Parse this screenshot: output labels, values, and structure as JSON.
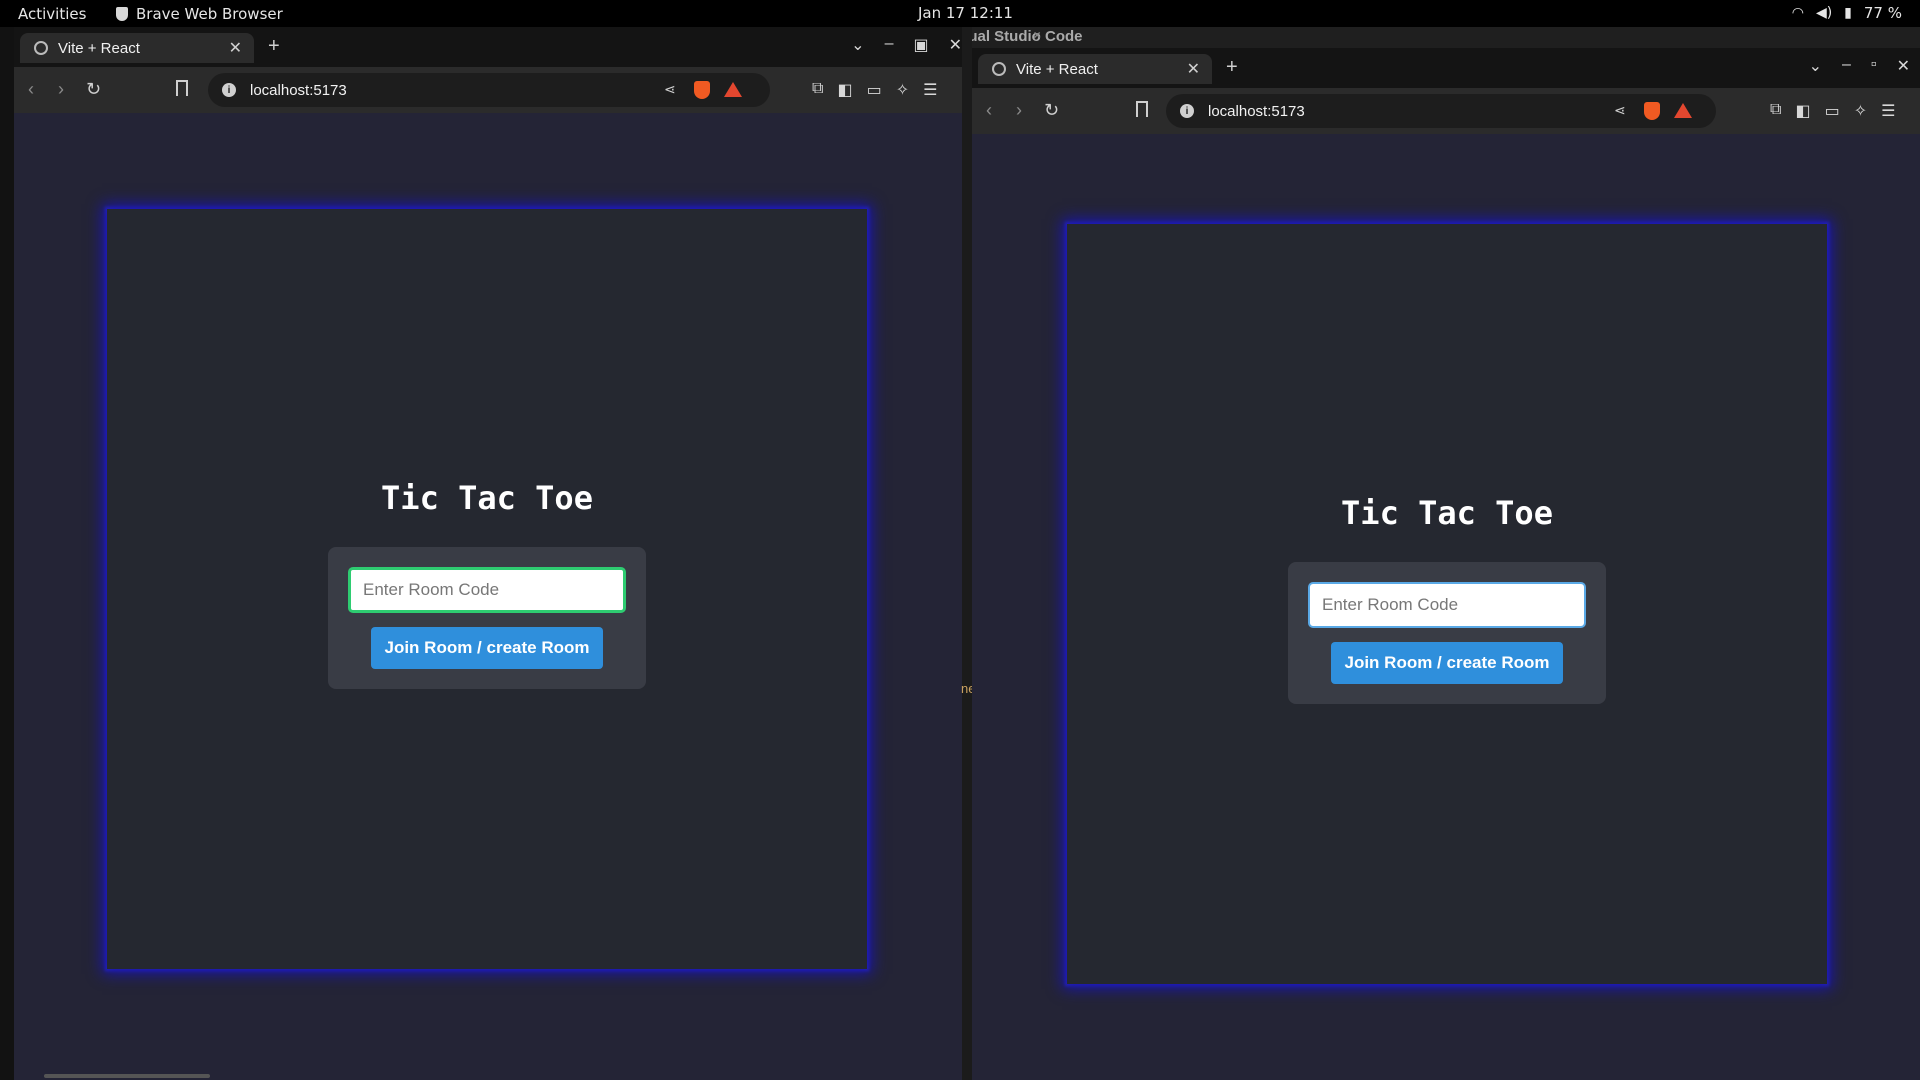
{
  "topbar": {
    "activities": "Activities",
    "app_name": "Brave Web Browser",
    "clock": "Jan 17  12:11",
    "battery": "77 %"
  },
  "background_window": {
    "title": "sual Studio Code",
    "edge_text": "ne"
  },
  "browser_left": {
    "tab_title": "Vite + React",
    "url": "localhost:5173",
    "app": {
      "title": "Tic Tac Toe",
      "input_placeholder": "Enter Room Code",
      "input_value": "",
      "input_focused": true,
      "button_label": "Join Room / create Room"
    }
  },
  "browser_right": {
    "tab_title": "Vite + React",
    "url": "localhost:5173",
    "app": {
      "title": "Tic Tac Toe",
      "input_placeholder": "Enter Room Code",
      "input_value": "",
      "input_focused": false,
      "button_label": "Join Room / create Room"
    }
  },
  "colors": {
    "page_bg": "#242436",
    "card_bg": "#252830",
    "glow": "#1a16a8",
    "form_bg": "#393c45",
    "button": "#2f8fdc",
    "focus_border": "#2ecc71"
  },
  "icons": [
    "globe-icon",
    "close-icon",
    "plus-icon",
    "back-icon",
    "forward-icon",
    "reload-icon",
    "bookmark-icon",
    "info-icon",
    "share-icon",
    "brave-shield-icon",
    "bat-rewards-icon",
    "extensions-icon",
    "sidebar-icon",
    "wallet-icon",
    "leo-icon",
    "menu-icon",
    "wifi-icon",
    "volume-icon",
    "battery-icon"
  ]
}
